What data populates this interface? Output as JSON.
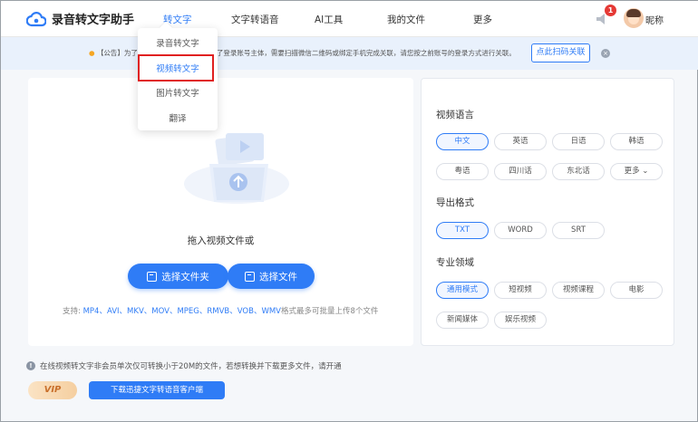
{
  "header": {
    "app_title": "录音转文字助手",
    "nav": [
      {
        "label": "转文字"
      },
      {
        "label": "文字转语音"
      },
      {
        "label": "AI工具"
      },
      {
        "label": "我的文件"
      },
      {
        "label": "更多"
      }
    ],
    "notification_count": "1",
    "username": "昵称"
  },
  "notice": {
    "text_prefix": "【公告】为了",
    "text_main": "更新了登录账号主体，需要扫描微信二维码或绑定手机完成关联，请您按之前账号的登录方式进行关联。",
    "button_label": "点此扫码关联",
    "close_symbol": "×"
  },
  "dropdown": {
    "items": [
      {
        "label": "录音转文字"
      },
      {
        "label": "视频转文字"
      },
      {
        "label": "图片转文字"
      },
      {
        "label": "翻译"
      }
    ]
  },
  "upload": {
    "drop_text": "拖入视频文件或",
    "select_folder_label": "选择文件夹",
    "select_file_label": "选择文件",
    "support_prefix": "支持:",
    "formats": "MP4、AVI、MKV、MOV、MPEG、RMVB、VOB、WMV",
    "support_suffix": "格式最多可批量上传8个文件"
  },
  "settings": {
    "language_title": "视频语言",
    "languages": [
      {
        "label": "中文",
        "selected": true
      },
      {
        "label": "英语",
        "selected": false
      },
      {
        "label": "日语",
        "selected": false
      },
      {
        "label": "韩语",
        "selected": false
      },
      {
        "label": "粤语",
        "selected": false
      },
      {
        "label": "四川话",
        "selected": false
      },
      {
        "label": "东北话",
        "selected": false
      },
      {
        "label": "更多 ⌄",
        "selected": false
      }
    ],
    "export_title": "导出格式",
    "formats": [
      {
        "label": "TXT",
        "selected": true
      },
      {
        "label": "WORD",
        "selected": false
      },
      {
        "label": "SRT",
        "selected": false
      }
    ],
    "domain_title": "专业领域",
    "domains": [
      {
        "label": "通用模式",
        "selected": true
      },
      {
        "label": "短视频",
        "selected": false
      },
      {
        "label": "视频课程",
        "selected": false
      },
      {
        "label": "电影",
        "selected": false
      },
      {
        "label": "新闻媒体",
        "selected": false
      },
      {
        "label": "娱乐视频",
        "selected": false
      }
    ]
  },
  "footer": {
    "tip": "在线视频转文字非会员单次仅可转换小于20M的文件，若想转换并下载更多文件，请开通",
    "vip_label": "VIP",
    "download_label": "下载迅捷文字转语音客户端"
  },
  "colors": {
    "accent": "#2f7cf6",
    "highlight_box": "#e02020",
    "notice_bg": "#e9f1fc"
  }
}
